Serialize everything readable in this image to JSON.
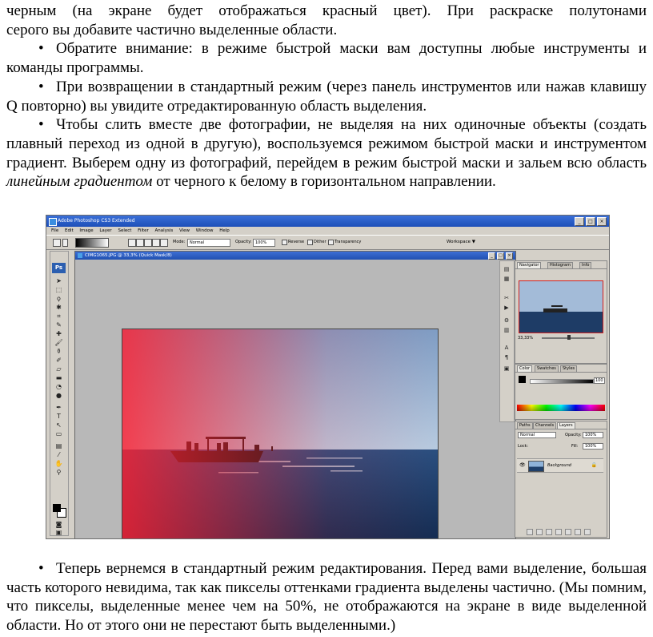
{
  "top_text": {
    "p1_line1": "черным (на экране будет отображаться красный цвет). При раскраске полутонами",
    "p1_line2": "серого вы добавите частично выделенные области.",
    "b1": "Обратите внимание: в режиме быстрой маски вам доступны любые инструменты и команды программы.",
    "b2": "При возвращении в стандартный режим (через панель инструментов или нажав клавишу Q повторно) вы увидите отредактированную область выделения.",
    "b3_pre": "Чтобы слить вместе две фотографии, не выделяя на них одиночные объекты (создать плавный переход из одной в другую), воспользуемся режимом быстрой маски и инструментом градиент. Выберем одну из фотографий, перейдем в режим быстрой маски и зальем всю область ",
    "b3_italic": "линейным градиентом",
    "b3_post": " от черного к белому в горизонтальном направлении."
  },
  "bottom_text": {
    "b4": "Теперь вернемся в стандартный режим редактирования. Перед вами выделение, большая часть которого невидима, так как пикселы оттенками градиента выделены частично. (Мы помним, что пикселы, выделенные менее чем на 50%, не отображаются на экране в виде выделенной области. Но от этого они не перестают быть выделенными.)"
  },
  "bullet_symbol": "•",
  "photoshop": {
    "title": "Adobe Photoshop CS3 Extended",
    "window_buttons": [
      "_",
      "□",
      "×"
    ],
    "menu": [
      "File",
      "Edit",
      "Image",
      "Layer",
      "Select",
      "Filter",
      "Analysis",
      "View",
      "Window",
      "Help"
    ],
    "options": {
      "mode_label": "Mode:",
      "mode_value": "Normal",
      "opacity_label": "Opacity:",
      "opacity_value": "100%",
      "reverse": "Reverse",
      "dither": "Dither",
      "transparency": "Transparency",
      "workspace": "Workspace ▼"
    },
    "toolbox_logo": "Ps",
    "document_title": "CIMG1065.JPG @ 33,3% (Quick Mask/8)",
    "navigator": {
      "tabs": [
        "Navigator",
        "Histogram",
        "Info"
      ],
      "zoom": "33,33%"
    },
    "color_panel": {
      "tabs": [
        "Color",
        "Swatches",
        "Styles"
      ],
      "value": "100"
    },
    "layers_panel": {
      "tabs": [
        "Paths",
        "Channels",
        "Layers"
      ],
      "blend": "Normal",
      "opacity_label": "Opacity:",
      "opacity": "100%",
      "lock_label": "Lock:",
      "fill_label": "Fill:",
      "fill": "100%",
      "layer_name": "Background"
    },
    "colors": {
      "quick_mask_red": "#e0323c",
      "sky": "#9fb9d6",
      "sea": "#1c3a63"
    }
  }
}
